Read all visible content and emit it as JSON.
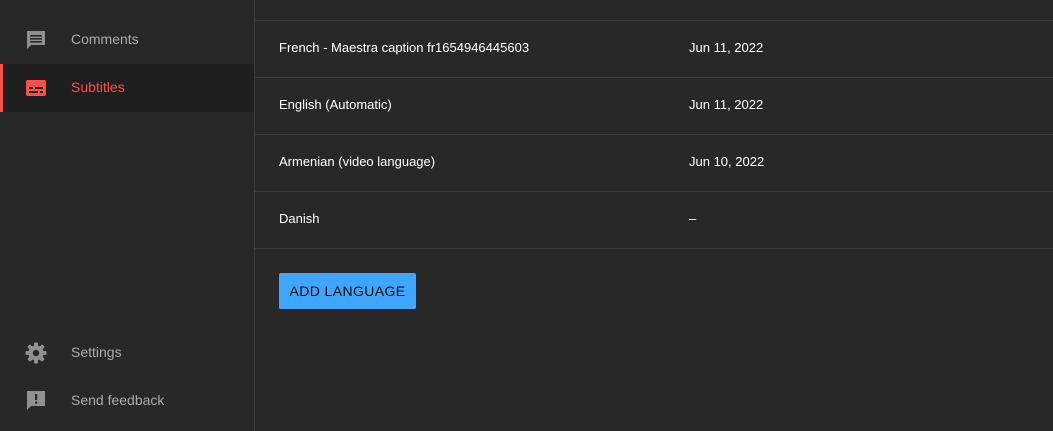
{
  "sidebar": {
    "items": [
      {
        "label": "Comments",
        "icon": "comment-icon"
      },
      {
        "label": "Subtitles",
        "icon": "subtitles-icon",
        "active": true
      }
    ],
    "bottom_items": [
      {
        "label": "Settings",
        "icon": "gear-icon"
      },
      {
        "label": "Send feedback",
        "icon": "feedback-icon"
      }
    ]
  },
  "subtitles": {
    "rows": [
      {
        "language": "French - Maestra caption fr1654946445603",
        "date": "Jun 11, 2022"
      },
      {
        "language": "English (Automatic)",
        "date": "Jun 11, 2022"
      },
      {
        "language": "Armenian (video language)",
        "date": "Jun 10, 2022"
      },
      {
        "language": "Danish",
        "date": "–"
      }
    ],
    "add_button_label": "ADD LANGUAGE"
  },
  "colors": {
    "background": "#282828",
    "active_accent": "#ff4e45",
    "button_blue": "#3ea6ff",
    "muted_text": "#aaaaaa"
  }
}
